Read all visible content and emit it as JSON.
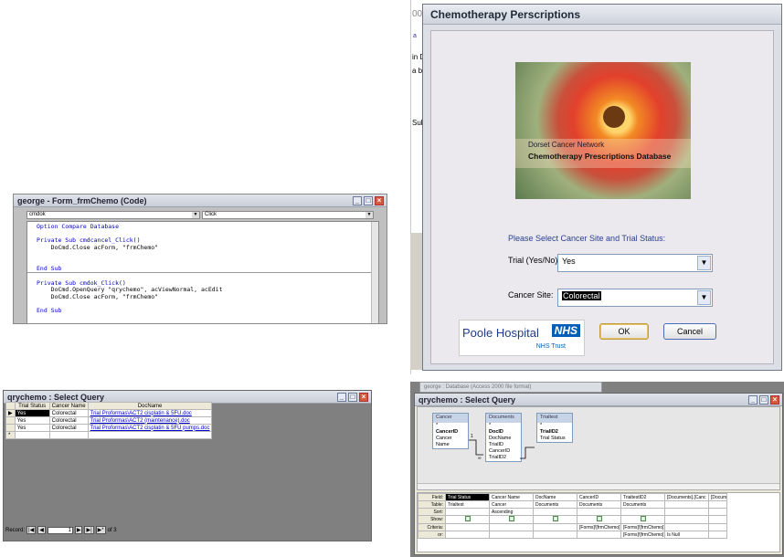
{
  "partial_window": {
    "title_fragment": "000",
    "snippets": [
      "a",
      "in D",
      "a by",
      "Subf"
    ]
  },
  "chemo_form": {
    "title": "Chemotherapy Perscriptions",
    "banner_org": "Dorset Cancer Network",
    "banner_title": "Chemotherapy Prescriptions Database",
    "prompt": "Please Select Cancer Site and Trial Status:",
    "trial_label": "Trial (Yes/No)",
    "trial_value": "Yes",
    "site_label": "Cancer Site:",
    "site_value": "Colorectal",
    "logo_name": "Poole Hospital",
    "logo_nhs": "NHS",
    "logo_trust": "NHS Trust",
    "ok_label": "OK",
    "cancel_label": "Cancel"
  },
  "code_window": {
    "title": "george - Form_frmChemo (Code)",
    "object_combo": "cmdok",
    "proc_combo": "Click",
    "lines": [
      [
        "kw",
        "Option Compare Database"
      ],
      [
        "",
        ""
      ],
      [
        "kw",
        "Private Sub cmdcancel_Click()"
      ],
      [
        "",
        "    DoCmd.Close acForm, \"frmChemo\""
      ],
      [
        "",
        ""
      ],
      [
        "",
        ""
      ],
      [
        "kw",
        "End Sub"
      ],
      [
        "",
        ""
      ],
      [
        "kw",
        "Private Sub cmdok_Click()"
      ],
      [
        "",
        "    DoCmd.OpenQuery \"qrychemo\", acViewNormal, acEdit"
      ],
      [
        "",
        "    DoCmd.Close acForm, \"frmChemo\""
      ],
      [
        "",
        ""
      ],
      [
        "kw",
        "End Sub"
      ]
    ]
  },
  "select_query": {
    "title": "qrychemo : Select Query",
    "columns": [
      "Trial Status",
      "Cancer Name",
      "DocName"
    ],
    "rows": [
      [
        "Yes",
        "Colorectal",
        "Trial Proformas\\ACT2 cisplatin & 5FU.doc"
      ],
      [
        "Yes",
        "Colorectal",
        "Trial Proformas\\ACT2 (maintenance).doc"
      ],
      [
        "Yes",
        "Colorectal",
        "Trial Proformas\\ACT2 cisplatin & 5FU pumps.doc"
      ]
    ],
    "record_label": "Record:",
    "record_num": "1",
    "record_of": "of 3"
  },
  "design_view": {
    "db_title": "george : Database (Access 2000 file format)",
    "title": "qrychemo : Select Query",
    "tables": [
      {
        "name": "Cancer",
        "fields": [
          "*",
          "CancerID",
          "Cancer Name"
        ]
      },
      {
        "name": "Documents",
        "fields": [
          "*",
          "DocID",
          "DocName",
          "TrialID",
          "CancerID",
          "TrialID2"
        ]
      },
      {
        "name": "Trialtest",
        "fields": [
          "*",
          "TrialID2",
          "Trial Status"
        ]
      }
    ],
    "row_labels": [
      "Field:",
      "Table:",
      "Sort:",
      "Show:",
      "Criteria:",
      "or:"
    ],
    "columns": [
      {
        "field": "Trial Status",
        "table": "Trialtest",
        "sort": "",
        "criteria": "",
        "or": ""
      },
      {
        "field": "Cancer Name",
        "table": "Cancer",
        "sort": "Ascending",
        "criteria": "",
        "or": ""
      },
      {
        "field": "DocName",
        "table": "Documents",
        "sort": "",
        "criteria": "",
        "or": ""
      },
      {
        "field": "CancerID",
        "table": "Documents",
        "sort": "",
        "criteria": "[Forms]![frmChemo]![CboCancer]",
        "or": ""
      },
      {
        "field": "TrialtestID2",
        "table": "Documents",
        "sort": "",
        "criteria": "[Forms]![frmChemo]![CboTrial]",
        "or": "[Forms]![frmChemo]![CboTrial]"
      },
      {
        "field": "[Documents].[Canc",
        "table": "",
        "sort": "",
        "criteria": "",
        "or": "Is Null"
      },
      {
        "field": "[Docum",
        "table": "",
        "sort": "",
        "criteria": "",
        "or": ""
      }
    ]
  }
}
